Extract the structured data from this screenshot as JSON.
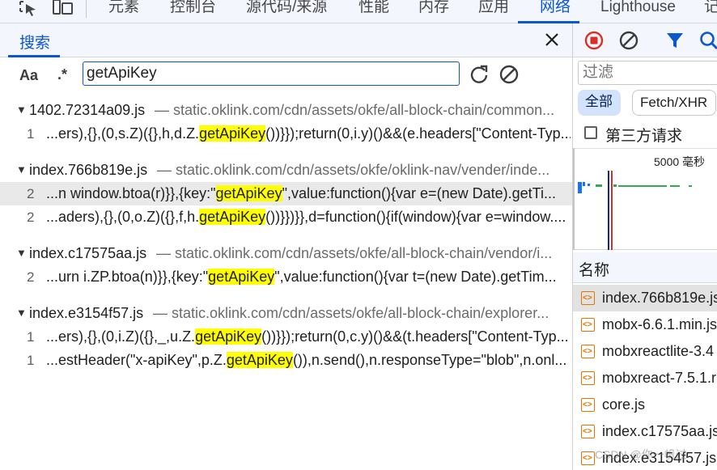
{
  "tabs": [
    {
      "label": "元素"
    },
    {
      "label": "控制台"
    },
    {
      "label": "源代码/来源"
    },
    {
      "label": "性能"
    },
    {
      "label": "内存"
    },
    {
      "label": "应用"
    },
    {
      "label": "网络"
    },
    {
      "label": "Lighthouse"
    },
    {
      "label": "记"
    }
  ],
  "search": {
    "title": "搜索",
    "match_case_label": "Aa",
    "regex_label": ".*",
    "query": "getApiKey",
    "results": [
      {
        "file": "1402.72314a09.js",
        "url": "— static.oklink.com/cdn/assets/okfe/all-block-chain/common...",
        "matches": [
          {
            "line": "1",
            "pre": "...ers),{},(0,s.Z)({},h,d.Z.",
            "hit": "getApiKey",
            "post": "())}});return(0,i.y)()&&(e.headers[\"Content-Typ..."
          }
        ]
      },
      {
        "file": "index.766b819e.js",
        "url": "— static.oklink.com/cdn/assets/okfe/oklink-nav/vender/inde...",
        "matches": [
          {
            "line": "2",
            "pre": "...n window.btoa(r)}},{key:\"",
            "hit": "getApiKey",
            "post": "\",value:function(){var e=(new Date).getTi..."
          },
          {
            "line": "2",
            "pre": "...aders),{},(0,o.Z)({},f,h.",
            "hit": "getApiKey",
            "post": "())}})}},d=function(){if(window){var e=window...."
          }
        ]
      },
      {
        "file": "index.c17575aa.js",
        "url": "— static.oklink.com/cdn/assets/okfe/all-block-chain/vendor/i...",
        "matches": [
          {
            "line": "2",
            "pre": "...urn i.ZP.btoa(n)}},{key:\"",
            "hit": "getApiKey",
            "post": "\",value:function(){var t=(new Date).getTim..."
          }
        ]
      },
      {
        "file": "index.e3154f57.js",
        "url": "— static.oklink.com/cdn/assets/okfe/all-block-chain/explorer...",
        "matches": [
          {
            "line": "1",
            "pre": "...ers),{},(0,i.Z)({},_,u.Z.",
            "hit": "getApiKey",
            "post": "())}});return(0,c.y)()&&(t.headers[\"Content-Typ..."
          },
          {
            "line": "1",
            "pre": "...estHeader(\"x-apiKey\",p.Z.",
            "hit": "getApiKey",
            "post": "()),n.send(),n.responseType=\"blob\",n.onl..."
          }
        ]
      }
    ]
  },
  "network": {
    "filter_placeholder": "过滤",
    "chip_all": "全部",
    "chip_fetch": "Fetch/XHR",
    "third_party_label": "第三方请求",
    "timing_label": "5000 毫秒",
    "name_header": "名称",
    "requests": [
      {
        "name": "index.766b819e.js"
      },
      {
        "name": "mobx-6.6.1.min.js"
      },
      {
        "name": "mobxreactlite-3.4"
      },
      {
        "name": "mobxreact-7.5.1.r"
      },
      {
        "name": "core.js"
      },
      {
        "name": "index.c17575aa.js"
      },
      {
        "name": "index.e3154f57.js"
      }
    ]
  },
  "watermark": "CSDN @你一帆过"
}
